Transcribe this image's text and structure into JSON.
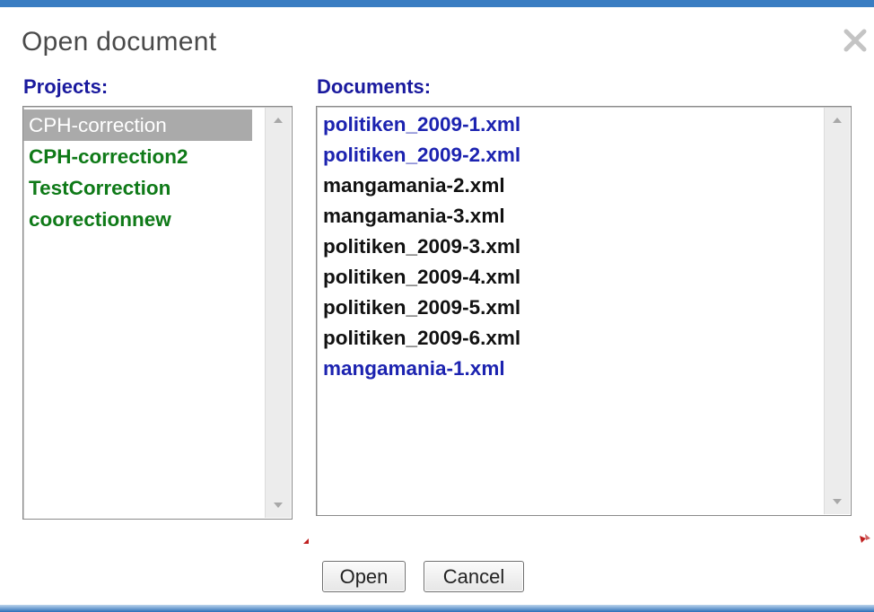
{
  "dialog": {
    "title": "Open document",
    "close_icon": "close-icon",
    "accent_color": "#3a7dc2"
  },
  "projects": {
    "label": "Projects:",
    "items": [
      {
        "label": "CPH-correction",
        "selected": true
      },
      {
        "label": "CPH-correction2"
      },
      {
        "label": "TestCorrection"
      },
      {
        "label": "coorectionnew"
      }
    ],
    "item_color": "#0f7a18"
  },
  "documents": {
    "label": "Documents:",
    "items": [
      {
        "label": "politiken_2009-1.xml",
        "color": "blue"
      },
      {
        "label": "politiken_2009-2.xml",
        "color": "blue"
      },
      {
        "label": "mangamania-2.xml",
        "color": "black"
      },
      {
        "label": "mangamania-3.xml",
        "color": "black"
      },
      {
        "label": "politiken_2009-3.xml",
        "color": "black"
      },
      {
        "label": "politiken_2009-4.xml",
        "color": "black"
      },
      {
        "label": "politiken_2009-5.xml",
        "color": "black"
      },
      {
        "label": "politiken_2009-6.xml",
        "color": "black"
      },
      {
        "label": "mangamania-1.xml",
        "color": "blue"
      }
    ]
  },
  "buttons": {
    "open_label": "Open",
    "cancel_label": "Cancel"
  }
}
